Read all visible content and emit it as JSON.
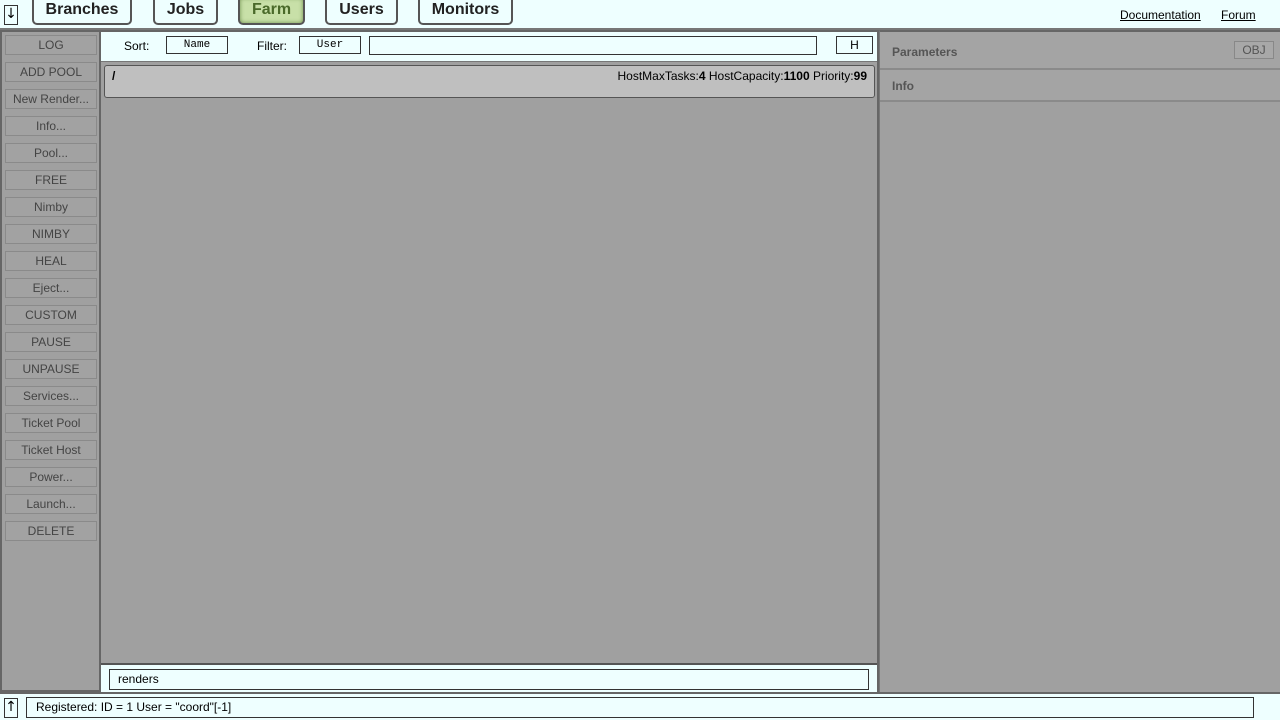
{
  "topbar": {
    "toggle_icon": "↓",
    "tabs": [
      {
        "label": "Branches",
        "active": false
      },
      {
        "label": "Jobs",
        "active": false
      },
      {
        "label": "Farm",
        "active": true
      },
      {
        "label": "Users",
        "active": false
      },
      {
        "label": "Monitors",
        "active": false
      }
    ],
    "links": {
      "documentation": "Documentation",
      "forum": "Forum"
    }
  },
  "sidebar": {
    "buttons": [
      "LOG",
      "ADD POOL",
      "New Render...",
      "Info...",
      "Pool...",
      "FREE",
      "Nimby",
      "NIMBY",
      "HEAL",
      "Eject...",
      "CUSTOM",
      "PAUSE",
      "UNPAUSE",
      "Services...",
      "Ticket Pool",
      "Ticket Host",
      "Power...",
      "Launch...",
      "DELETE"
    ]
  },
  "controls": {
    "sort_label": "Sort:",
    "sort_value": "Name",
    "filter_label": "Filter:",
    "filter_value": "User",
    "filter_text": "",
    "h_button": "H"
  },
  "pool": {
    "name": "/",
    "max_tasks_label": "HostMaxTasks:",
    "max_tasks": "4",
    "capacity_label": "HostCapacity:",
    "capacity": "1100",
    "priority_label": "Priority:",
    "priority": "99"
  },
  "bottom": {
    "value": "renders"
  },
  "right": {
    "parameters_title": "Parameters",
    "obj_button": "OBJ",
    "info_title": "Info"
  },
  "status": {
    "toggle_icon": "↑",
    "text": "Registered: ID = 1 User = \"coord\"[-1]"
  },
  "colors": {
    "background": "#a0a0a0",
    "bar": "#eeffff",
    "active_tab": "#c8e0a8"
  }
}
